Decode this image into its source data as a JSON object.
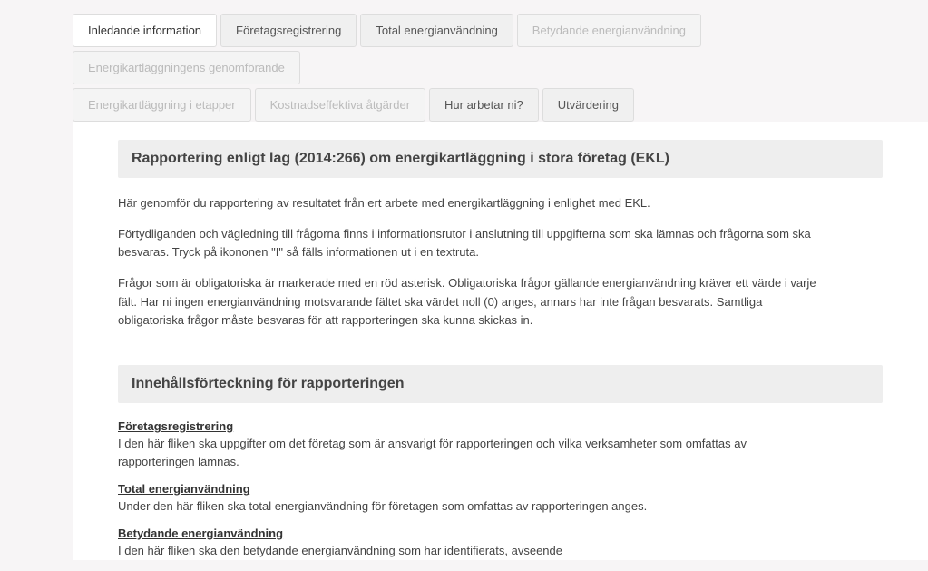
{
  "tabs": {
    "row1": [
      {
        "label": "Inledande information",
        "state": "active"
      },
      {
        "label": "Företagsregistrering",
        "state": "normal"
      },
      {
        "label": "Total energianvändning",
        "state": "normal"
      },
      {
        "label": "Betydande energianvändning",
        "state": "disabled"
      },
      {
        "label": "Energikartläggningens genomförande",
        "state": "disabled"
      }
    ],
    "row2": [
      {
        "label": "Energikartläggning i etapper",
        "state": "disabled"
      },
      {
        "label": "Kostnadseffektiva åtgärder",
        "state": "disabled"
      },
      {
        "label": "Hur arbetar ni?",
        "state": "normal"
      },
      {
        "label": "Utvärdering",
        "state": "normal"
      }
    ]
  },
  "section1": {
    "header": "Rapportering enligt lag (2014:266) om energikartläggning i stora företag (EKL)",
    "p1": "Här genomför du rapportering av resultatet från ert arbete med energikartläggning i enlighet med EKL.",
    "p2": "Förtydliganden och vägledning till frågorna finns i informationsrutor i anslutning till uppgifterna som ska lämnas och frågorna som ska besvaras. Tryck på ikononen \"I\" så fälls informationen ut i en textruta.",
    "p3": "Frågor som är obligatoriska är markerade med en röd asterisk. Obligatoriska frågor gällande energianvändning kräver ett värde i varje fält. Har ni ingen energianvändning motsvarande fältet ska värdet noll (0) anges, annars har inte frågan besvarats. Samtliga obligatoriska frågor måste besvaras för att rapporteringen ska kunna skickas in."
  },
  "section2": {
    "header": "Innehållsförteckning för rapporteringen",
    "items": [
      {
        "title": "Företagsregistrering",
        "desc": "I den här fliken ska uppgifter om det företag som är ansvarigt för rapporteringen och vilka verksamheter som omfattas av rapporteringen lämnas."
      },
      {
        "title": "Total energianvändning",
        "desc": "Under den här fliken ska total energianvändning för företagen som omfattas av rapporteringen anges."
      },
      {
        "title": "Betydande energianvändning",
        "desc": "I den här fliken ska den betydande energianvändning som har identifierats, avseende"
      }
    ]
  }
}
